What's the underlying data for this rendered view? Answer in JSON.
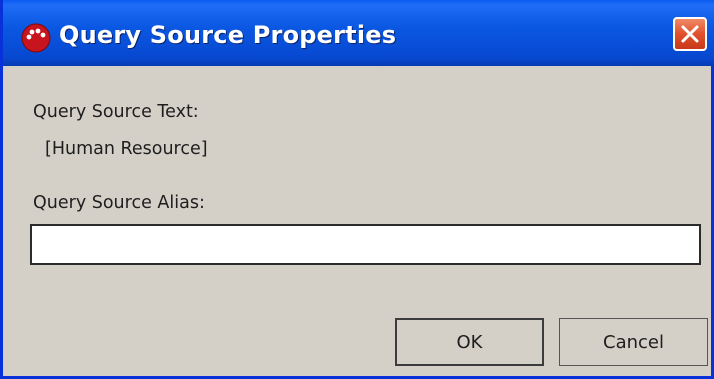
{
  "window": {
    "title": "Query Source Properties",
    "icon": "red-ball-app-icon",
    "close_icon": "close-icon"
  },
  "content": {
    "source_text_label": "Query Source Text:",
    "source_text_value": "[Human Resource]",
    "alias_label": "Query Source Alias:",
    "alias_value": "",
    "alias_placeholder": ""
  },
  "buttons": {
    "ok_label": "OK",
    "cancel_label": "Cancel"
  },
  "colors": {
    "titlebar": "#0b58e3",
    "close_button": "#e0512c",
    "dialog_background": "#d4d0c8"
  }
}
